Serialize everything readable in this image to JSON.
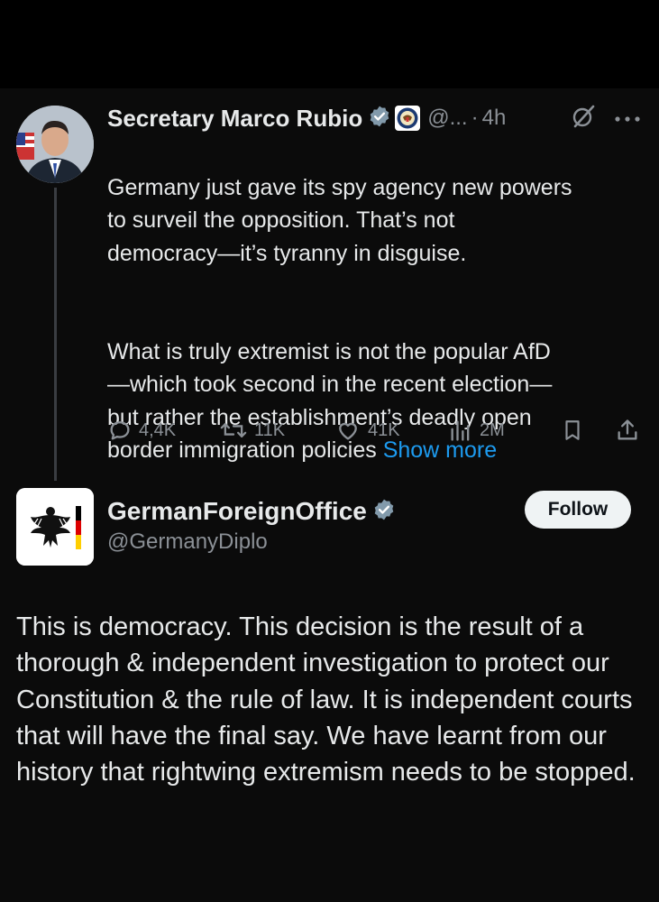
{
  "reply_tweet": {
    "author_name": "Secretary Marco Rubio",
    "handle": "@...",
    "separator": "·",
    "time": "4h",
    "paragraph_1": "Germany just gave its spy agency new powers\nto surveil the opposition.  That’s not\ndemocracy—it’s tyranny in disguise.",
    "paragraph_2": "What is truly extremist is not the popular AfD\n—which took second in the recent election—\nbut rather the establishment’s deadly open\nborder immigration policies ",
    "show_more": "Show more",
    "stats": {
      "replies": "4,4K",
      "reposts": "11K",
      "likes": "41K",
      "views": "2M"
    }
  },
  "quoted_tweet": {
    "author_name": "GermanForeignOffice",
    "handle": "@GermanyDiplo",
    "follow_label": "Follow",
    "text": "This is democracy. This decision is the result of a thorough & independent investigation to protect our Constitution & the rule of law. It is independent courts that will have the final say. We have learnt from our history that rightwing extremism needs to be stopped."
  },
  "colors": {
    "background": "#000000",
    "text": "#e7e9ea",
    "muted": "#8b9096",
    "link": "#1d9bf0",
    "verified_gray": "#829aab",
    "follow_bg": "#eff3f4"
  },
  "icons": [
    "verified-badge-icon",
    "state-department-seal-icon",
    "grok-icon",
    "more-icon",
    "reply-icon",
    "repost-icon",
    "like-icon",
    "views-icon",
    "bookmark-icon",
    "share-icon",
    "federal-eagle-logo"
  ]
}
